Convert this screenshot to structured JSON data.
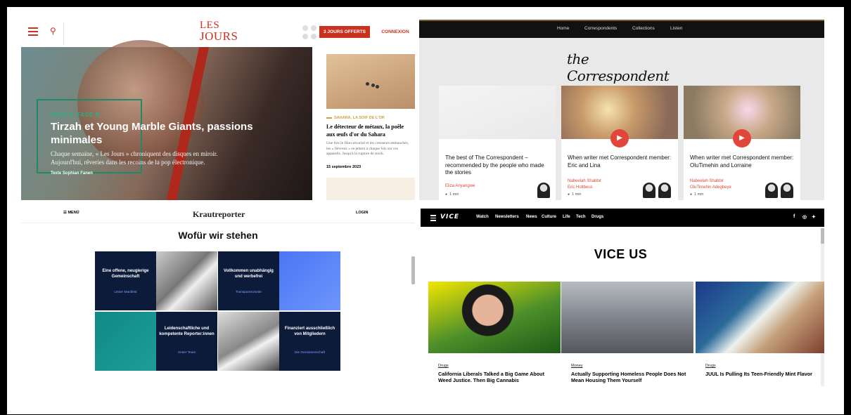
{
  "les_jours": {
    "logo_line1": "LES",
    "logo_line2": "JOURS",
    "offer_button": "3 JOURS OFFERTS",
    "login": "CONNEXION",
    "hero": {
      "kicker": "FACE A, FACE B",
      "title": "Tirzah et Young Marble Giants, passions minimales",
      "lede": "Chaque semaine, « Les Jours » chroniquent des disques en miroir. Aujourd'hui, rêveries dans les recoins de la pop électronique.",
      "byline": "Texte Sophian Fanen"
    },
    "side": {
      "tag": "SAHARA, LA SOIF DE L'OR",
      "title": "Le détecteur de métaux, la poêle aux œufs d'or du Sahara",
      "desc": "Une fois le filon sécurisé et les creuseurs embauchés, les « fièvreux » se jettent à chaque fois sur ces appareils. Jusqu'à la rupture de stock.",
      "date": "15 septembre 2023"
    }
  },
  "correspondent": {
    "nav": [
      "Home",
      "Correspondents",
      "Collections",
      "Listen"
    ],
    "logo": "the Correspondent",
    "cards": [
      {
        "title": "The best of The Correspondent – recommended by the people who made the stories",
        "author1": "Eliza Anyangwe",
        "author2": "",
        "duration": "1 min"
      },
      {
        "title": "When writer met Correspondent member: Eric and Lina",
        "author1": "Nabeelah Shabbir",
        "author2": "Eric Holtbeus",
        "duration": "1 min"
      },
      {
        "title": "When writer met Correspondent member: OluTimehin and Lorraine",
        "author1": "Nabeelah Shabbir",
        "author2": "OluTimehin Adegbeye",
        "duration": "1 min"
      }
    ]
  },
  "krautreporter": {
    "menu": "☰ MENÜ",
    "logo": "Krautreporter",
    "login": "LOGIN",
    "heading": "Wofür wir stehen",
    "tiles": [
      {
        "title": "Eine offene, neugierige Gemeinschaft",
        "link": "Unser Manifest"
      },
      {
        "title": "Vollkommen unabhängig und werbefrei",
        "link": "Transparenzseite"
      },
      {
        "title": "Leidenschaftliche und kompetente Reporter:innen",
        "link": "Unser Team"
      },
      {
        "title": "Finanziert ausschließlich von Mitgliedern",
        "link": "Die Genossenschaft"
      }
    ]
  },
  "vice": {
    "logo": "VICE",
    "nav": [
      "Watch",
      "Newsletters",
      "News",
      "Culture",
      "Life",
      "Tech",
      "Drugs"
    ],
    "social": [
      "f",
      "◎",
      "✦"
    ],
    "heading": "VICE US",
    "articles": [
      {
        "category": "Drugs",
        "title": "California Liberals Talked a Big Game About Weed Justice. Then Big Cannabis"
      },
      {
        "category": "Money",
        "title": "Actually Supporting Homeless People Does Not Mean Housing Them Yourself"
      },
      {
        "category": "Drugs",
        "title": "JUUL Is Pulling Its Teen-Friendly Mint Flavor"
      }
    ]
  },
  "colors": {
    "les_jours_red": "#c8321f",
    "correspondent_red": "#e2453a",
    "kraut_navy": "#0d1b3a",
    "kraut_blue": "#4a76f5",
    "kraut_teal": "#0f8a86"
  }
}
